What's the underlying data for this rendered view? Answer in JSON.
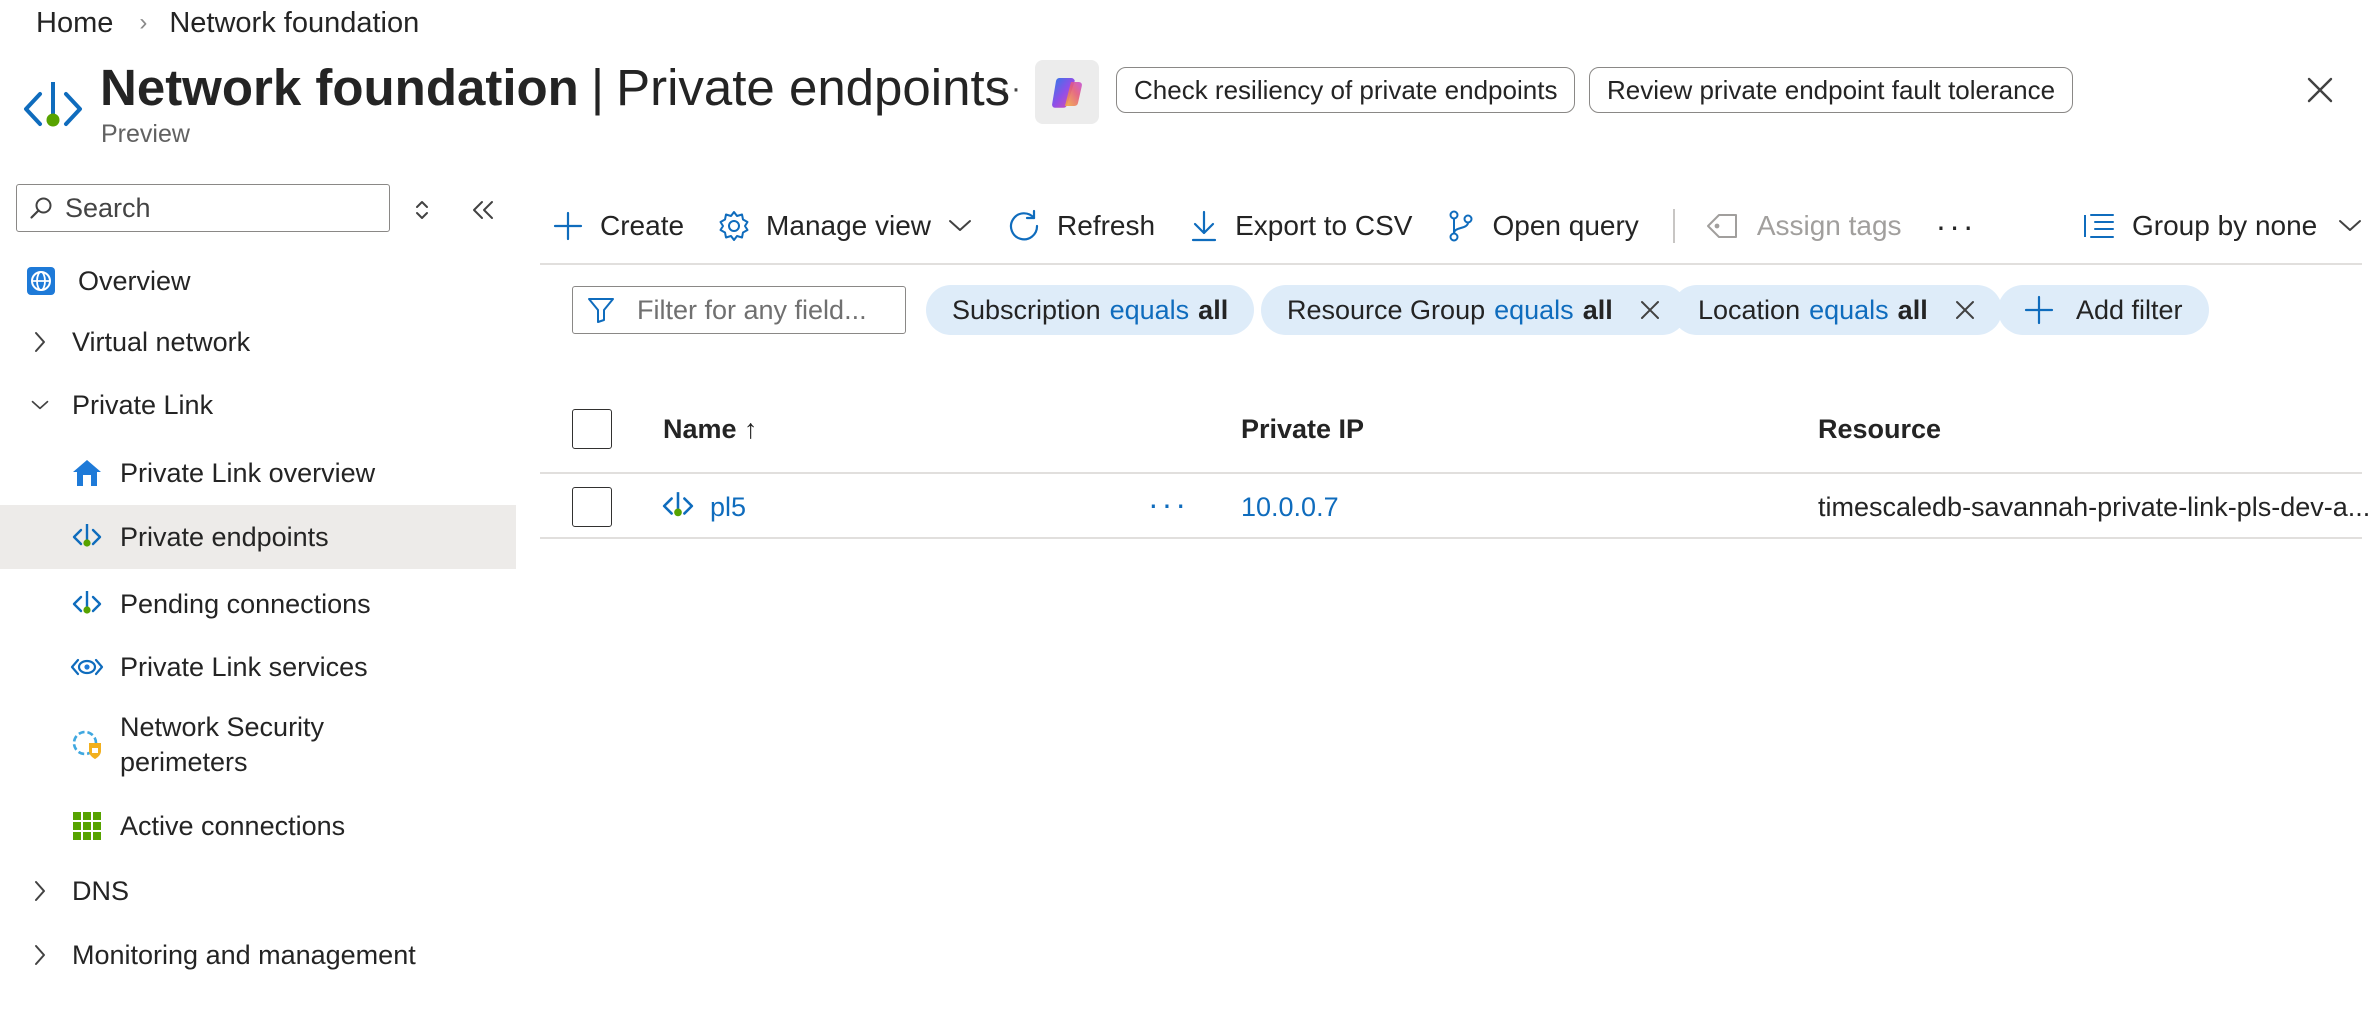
{
  "breadcrumb": {
    "items": [
      "Home",
      "Network foundation"
    ],
    "separator": "›"
  },
  "header": {
    "title_bold": "Network foundation",
    "title_sep": "|",
    "title_rest": "Private endpoints",
    "subtitle": "Preview",
    "more": "···",
    "prompts": [
      "Check resiliency of private endpoints",
      "Review private endpoint fault tolerance"
    ]
  },
  "nav": {
    "search_placeholder": "Search",
    "items": [
      {
        "label": "Overview",
        "icon": "globe-icon",
        "level": 0
      },
      {
        "label": "Virtual network",
        "level": 0,
        "expandable": true,
        "expanded": false
      },
      {
        "label": "Private Link",
        "level": 0,
        "expandable": true,
        "expanded": true
      },
      {
        "label": "Private Link overview",
        "icon": "home-icon",
        "level": 1
      },
      {
        "label": "Private endpoints",
        "icon": "private-endpoint-icon",
        "level": 1,
        "selected": true
      },
      {
        "label": "Pending connections",
        "icon": "pending-connections-icon",
        "level": 1
      },
      {
        "label": "Private Link services",
        "icon": "private-link-services-icon",
        "level": 1
      },
      {
        "label_line1": "Network Security",
        "label_line2": "perimeters",
        "icon": "network-security-perimeter-icon",
        "level": 1
      },
      {
        "label": "Active connections",
        "icon": "grid-icon",
        "level": 1
      },
      {
        "label": "DNS",
        "level": 0,
        "expandable": true,
        "expanded": false
      },
      {
        "label": "Monitoring and management",
        "level": 0,
        "expandable": true,
        "expanded": false
      }
    ]
  },
  "toolbar": {
    "create": "Create",
    "manage_view": "Manage view",
    "refresh": "Refresh",
    "export": "Export to CSV",
    "open_query": "Open query",
    "assign_tags": "Assign tags",
    "more": "···",
    "group_by": "Group by none"
  },
  "filters": {
    "placeholder": "Filter for any field...",
    "chips": [
      {
        "field": "Subscription",
        "op": "equals",
        "value": "all",
        "removable": false
      },
      {
        "field": "Resource Group",
        "op": "equals",
        "value": "all",
        "removable": true
      },
      {
        "field": "Location",
        "op": "equals",
        "value": "all",
        "removable": true
      }
    ],
    "add": "Add filter"
  },
  "table": {
    "columns": [
      "Name ↑",
      "Private IP",
      "Resource"
    ],
    "rows": [
      {
        "name": "pl5",
        "more": "···",
        "private_ip": "10.0.0.7",
        "resource": "timescaledb-savannah-private-link-pls-dev-a..."
      }
    ]
  },
  "colors": {
    "accent": "#0f6cbd",
    "chip_bg": "#deecf9",
    "selected_nav_bg": "#edebe9",
    "border": "#8a8886"
  }
}
